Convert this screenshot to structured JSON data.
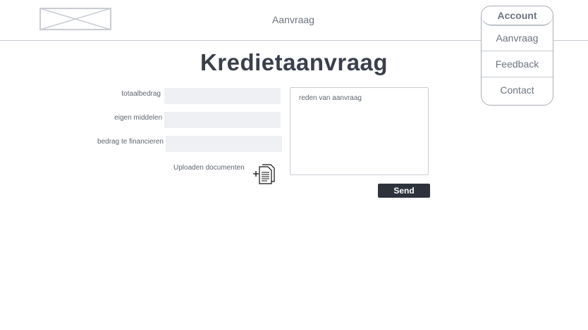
{
  "header": {
    "logo_icon": "image-placeholder-icon",
    "nav_link": "Aanvraag"
  },
  "menu": {
    "head": "Account",
    "items": [
      "Aanvraag",
      "Feedback",
      "Contact"
    ]
  },
  "page": {
    "title": "Kredietaanvraag"
  },
  "form": {
    "fields": [
      {
        "label": "totaalbedrag",
        "value": ""
      },
      {
        "label": "eigen middelen",
        "value": ""
      },
      {
        "label": "bedrag te financieren",
        "value": ""
      }
    ],
    "upload_label": "Uploaden documenten",
    "upload_icon": "add-document-icon",
    "reason_placeholder": "reden van aanvraag",
    "send_label": "Send"
  },
  "colors": {
    "field_bg": "#eef0f3",
    "button_bg": "#2d323b",
    "text_dark": "#3a3f4b",
    "text_muted": "#6e7480"
  }
}
